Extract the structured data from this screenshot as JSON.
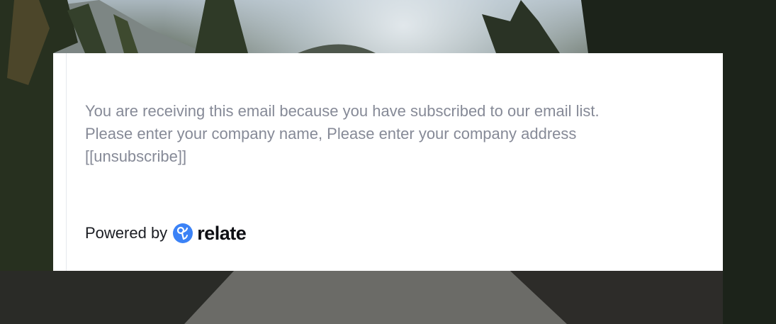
{
  "email_footer": {
    "notice_lines": [
      "You are receiving this email because you have subscribed to our email list.",
      "Please enter your company name, Please enter your company address",
      "[[unsubscribe]]"
    ],
    "powered_by_label": "Powered by",
    "brand_name": "relate",
    "brand_color": "#3b82f6",
    "brand_icon": "relate-logo-icon"
  },
  "background": {
    "description_icon": "forest-road-photo"
  }
}
